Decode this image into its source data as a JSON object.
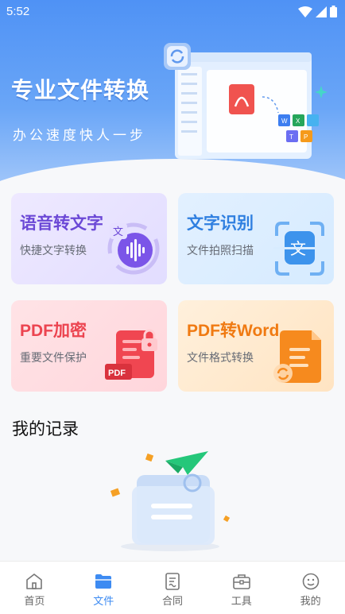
{
  "status_bar": {
    "time": "5:52"
  },
  "hero": {
    "title": "专业文件转换",
    "subtitle": "办公速度快人一步"
  },
  "features": [
    {
      "title": "语音转文字",
      "subtitle": "快捷文字转换",
      "icon": "voice-wave-icon",
      "color": "#6b48d6"
    },
    {
      "title": "文字识别",
      "subtitle": "文件拍照扫描",
      "icon": "text-scan-icon",
      "color": "#2f7fe0"
    },
    {
      "title": "PDF加密",
      "subtitle": "重要文件保护",
      "icon": "pdf-lock-icon",
      "color": "#ec4450"
    },
    {
      "title": "PDF转Word",
      "subtitle": "文件格式转换",
      "icon": "document-convert-icon",
      "color": "#f07a12"
    }
  ],
  "records": {
    "title": "我的记录"
  },
  "bottom_nav": {
    "active": "文件",
    "items": [
      {
        "label": "首页",
        "icon": "home-icon"
      },
      {
        "label": "文件",
        "icon": "folder-icon"
      },
      {
        "label": "合同",
        "icon": "contract-icon"
      },
      {
        "label": "工具",
        "icon": "toolbox-icon"
      },
      {
        "label": "我的",
        "icon": "profile-icon"
      }
    ]
  },
  "colors": {
    "accent": "#3d8bf2",
    "hero_top": "#4f92f5"
  }
}
